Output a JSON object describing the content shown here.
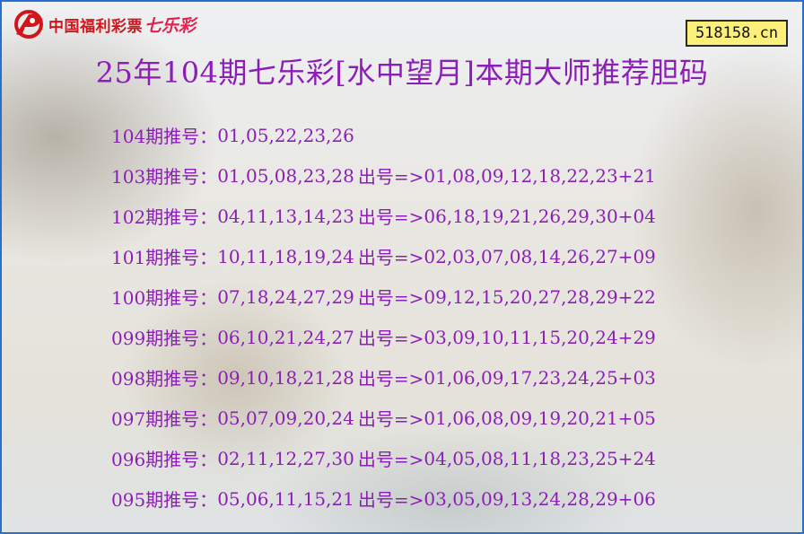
{
  "header": {
    "logo_text": "中国福利彩票",
    "logo_sub": "七乐彩",
    "site_badge": "518158.cn"
  },
  "title": "25年104期七乐彩[水中望月]本期大师推荐胆码",
  "rows": [
    {
      "issue": "104期推号：",
      "pick": "01,05,22,23,26",
      "result_label": "",
      "result": ""
    },
    {
      "issue": "103期推号：",
      "pick": "01,05,08,23,28",
      "result_label": "出号=>",
      "result": "01,08,09,12,18,22,23+21"
    },
    {
      "issue": "102期推号：",
      "pick": "04,11,13,14,23",
      "result_label": "出号=>",
      "result": "06,18,19,21,26,29,30+04"
    },
    {
      "issue": "101期推号：",
      "pick": "10,11,18,19,24",
      "result_label": "出号=>",
      "result": "02,03,07,08,14,26,27+09"
    },
    {
      "issue": "100期推号：",
      "pick": "07,18,24,27,29",
      "result_label": "出号=>",
      "result": "09,12,15,20,27,28,29+22"
    },
    {
      "issue": "099期推号：",
      "pick": "06,10,21,24,27",
      "result_label": "出号=>",
      "result": "03,09,10,11,15,20,24+29"
    },
    {
      "issue": "098期推号：",
      "pick": "09,10,18,21,28",
      "result_label": "出号=>",
      "result": "01,06,09,17,23,24,25+03"
    },
    {
      "issue": "097期推号：",
      "pick": "05,07,09,20,24",
      "result_label": "出号=>",
      "result": "01,06,08,09,19,20,21+05"
    },
    {
      "issue": "096期推号：",
      "pick": "02,11,12,27,30",
      "result_label": "出号=>",
      "result": "04,05,08,11,18,23,25+24"
    },
    {
      "issue": "095期推号：",
      "pick": "05,06,11,15,21",
      "result_label": "出号=>",
      "result": "03,05,09,13,24,28,29+06"
    }
  ]
}
